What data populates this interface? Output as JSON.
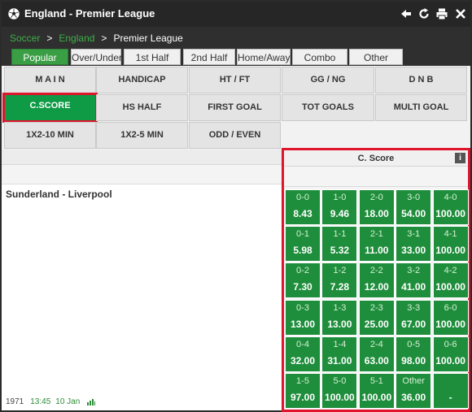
{
  "header": {
    "title": "England - Premier League",
    "icons": [
      "soccer-ball-icon",
      "back-arrow-icon",
      "refresh-icon",
      "print-icon",
      "close-icon"
    ]
  },
  "breadcrumb": {
    "items": [
      "Soccer",
      "England"
    ],
    "current": "Premier League",
    "separator": ">"
  },
  "tabs": [
    {
      "label": "Popular",
      "active": true
    },
    {
      "label": "Over/Under",
      "active": false
    },
    {
      "label": "1st Half",
      "active": false
    },
    {
      "label": "2nd Half",
      "active": false
    },
    {
      "label": "Home/Away",
      "active": false
    },
    {
      "label": "Combo",
      "active": false
    },
    {
      "label": "Other",
      "active": false
    }
  ],
  "categories": [
    {
      "label": "M A I N"
    },
    {
      "label": "HANDICAP"
    },
    {
      "label": "HT / FT"
    },
    {
      "label": "GG / NG"
    },
    {
      "label": "D N B"
    },
    {
      "label": "C.SCORE",
      "active": true
    },
    {
      "label": "HS HALF"
    },
    {
      "label": "FIRST GOAL"
    },
    {
      "label": "TOT GOALS"
    },
    {
      "label": "MULTI GOAL"
    },
    {
      "label": "1X2-10 MIN"
    },
    {
      "label": "1X2-5 MIN"
    },
    {
      "label": "ODD / EVEN"
    }
  ],
  "market": {
    "title": "C. Score",
    "info_label": "i"
  },
  "match": {
    "name": "Sunderland - Liverpool",
    "id": "1971",
    "time": "13:45",
    "date": "10 Jan"
  },
  "odds": [
    [
      {
        "score": "0-0",
        "price": "8.43"
      },
      {
        "score": "1-0",
        "price": "9.46"
      },
      {
        "score": "2-0",
        "price": "18.00"
      },
      {
        "score": "3-0",
        "price": "54.00"
      },
      {
        "score": "4-0",
        "price": "100.00"
      }
    ],
    [
      {
        "score": "0-1",
        "price": "5.98"
      },
      {
        "score": "1-1",
        "price": "5.32"
      },
      {
        "score": "2-1",
        "price": "11.00"
      },
      {
        "score": "3-1",
        "price": "33.00"
      },
      {
        "score": "4-1",
        "price": "100.00"
      }
    ],
    [
      {
        "score": "0-2",
        "price": "7.30"
      },
      {
        "score": "1-2",
        "price": "7.28"
      },
      {
        "score": "2-2",
        "price": "12.00"
      },
      {
        "score": "3-2",
        "price": "41.00"
      },
      {
        "score": "4-2",
        "price": "100.00"
      }
    ],
    [
      {
        "score": "0-3",
        "price": "13.00"
      },
      {
        "score": "1-3",
        "price": "13.00"
      },
      {
        "score": "2-3",
        "price": "25.00"
      },
      {
        "score": "3-3",
        "price": "67.00"
      },
      {
        "score": "6-0",
        "price": "100.00"
      }
    ],
    [
      {
        "score": "0-4",
        "price": "32.00"
      },
      {
        "score": "1-4",
        "price": "31.00"
      },
      {
        "score": "2-4",
        "price": "63.00"
      },
      {
        "score": "0-5",
        "price": "98.00"
      },
      {
        "score": "0-6",
        "price": "100.00"
      }
    ],
    [
      {
        "score": "1-5",
        "price": "97.00"
      },
      {
        "score": "5-0",
        "price": "100.00"
      },
      {
        "score": "5-1",
        "price": "100.00"
      },
      {
        "score": "Other",
        "price": "36.00"
      },
      {
        "score": "",
        "price": "-"
      }
    ]
  ],
  "colors": {
    "header_bg": "#262626",
    "accent_green": "#3a9e44",
    "odds_green": "#1f8e3c",
    "highlight_red": "#e0142b",
    "link_green": "#3fae49"
  }
}
